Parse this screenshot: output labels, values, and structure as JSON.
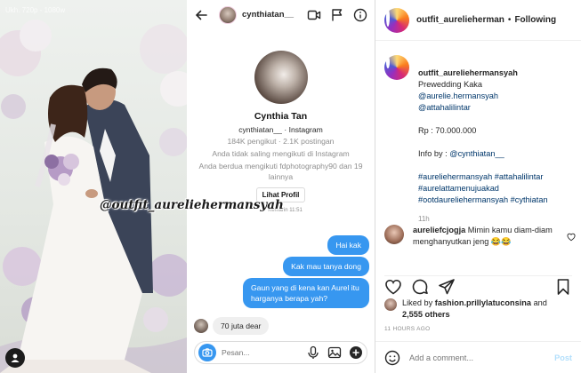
{
  "photo": {
    "watermark": "Ukh. 720p - 1080w",
    "overlay_handle": "@outfit_aurelieherman­syah"
  },
  "dm": {
    "header_username": "cynthiatan__",
    "profile_name": "Cynthia Tan",
    "profile_sub": "cynthiatan__ · Instagram",
    "stats": "184K pengikut · 2.1K postingan",
    "not_following": "Anda tidak saling mengikuti di Instagram",
    "mutual": "Anda berdua mengikuti fdphotography90 dan 19 lainnya",
    "view_profile_button": "Lihat Profil",
    "timestamp": "Kemarin 11:51",
    "messages_out": [
      "Hai kak",
      "Kak mau tanya dong",
      "Gaun yang di kena kan Aurel itu harganya berapa yah?"
    ],
    "message_in": "70 juta dear",
    "composer_placeholder": "Pesan..."
  },
  "post": {
    "username": "outfit_aurelieherman",
    "follow_status": "Following",
    "caption": {
      "user": "outfit_aurelieherman­syah",
      "line1": "Prewedding Kaka",
      "tag1": "@aurelie.hermansyah",
      "tag2": "@attahalilintar",
      "price": "Rp : 70.000.000",
      "info_prefix": "Info by : ",
      "info_tag": "@cynthiatan__",
      "hashtags1": "#aurelie­hermansyah #attahalilintar",
      "hashtags2": "#aurelattamenujuakad",
      "hashtags3": "#ootdaurelie­hermansyah #cythiatan",
      "time_ago": "11h"
    },
    "comment": {
      "user": "aureliefcjogja",
      "text": " Mimin kamu diam-diam menghanyutkan jeng",
      "emojis": "😂😂"
    },
    "likes": {
      "prefix": "Liked by ",
      "user": "fashion.prillylatuconsina",
      "and": " and",
      "others": "2,555 others"
    },
    "timestamp": "11 HOURS AGO",
    "add_comment_placeholder": "Add a comment...",
    "post_button": "Post"
  },
  "colors": {
    "accent_blue": "#3797f0",
    "post_button_disabled": "#b2dffc",
    "link": "#00376b"
  }
}
